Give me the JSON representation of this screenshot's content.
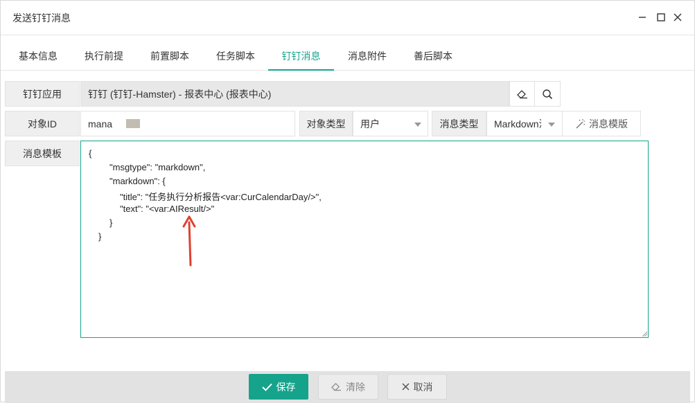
{
  "window": {
    "title": "发送钉钉消息"
  },
  "tabs": [
    {
      "label": "基本信息",
      "active": false
    },
    {
      "label": "执行前提",
      "active": false
    },
    {
      "label": "前置脚本",
      "active": false
    },
    {
      "label": "任务脚本",
      "active": false
    },
    {
      "label": "钉钉消息",
      "active": true
    },
    {
      "label": "消息附件",
      "active": false
    },
    {
      "label": "善后脚本",
      "active": false
    }
  ],
  "form": {
    "app_label": "钉钉应用",
    "app_value": "钉钉 (钉钉-Hamster) - 报表中心 (报表中心)",
    "object_id_label": "对象ID",
    "object_id_value": "mana",
    "object_type_label": "对象类型",
    "object_type_value": "用户",
    "message_type_label": "消息类型",
    "message_type_value": "Markdown消",
    "template_button": "消息模版",
    "template_label": "消息模板",
    "template_lines": [
      "{",
      "\"msgtype\": \"markdown\",",
      "\"markdown\": {",
      "\"title\": \"任务执行分析报告<var:CurCalendarDay/>\",",
      "\"text\": \"<var:AIResult/>\"",
      "}",
      "}"
    ]
  },
  "footer": {
    "save": "保存",
    "clear": "清除",
    "cancel": "取消"
  },
  "colors": {
    "accent": "#15a38c",
    "annotation_arrow": "#e0402f"
  }
}
